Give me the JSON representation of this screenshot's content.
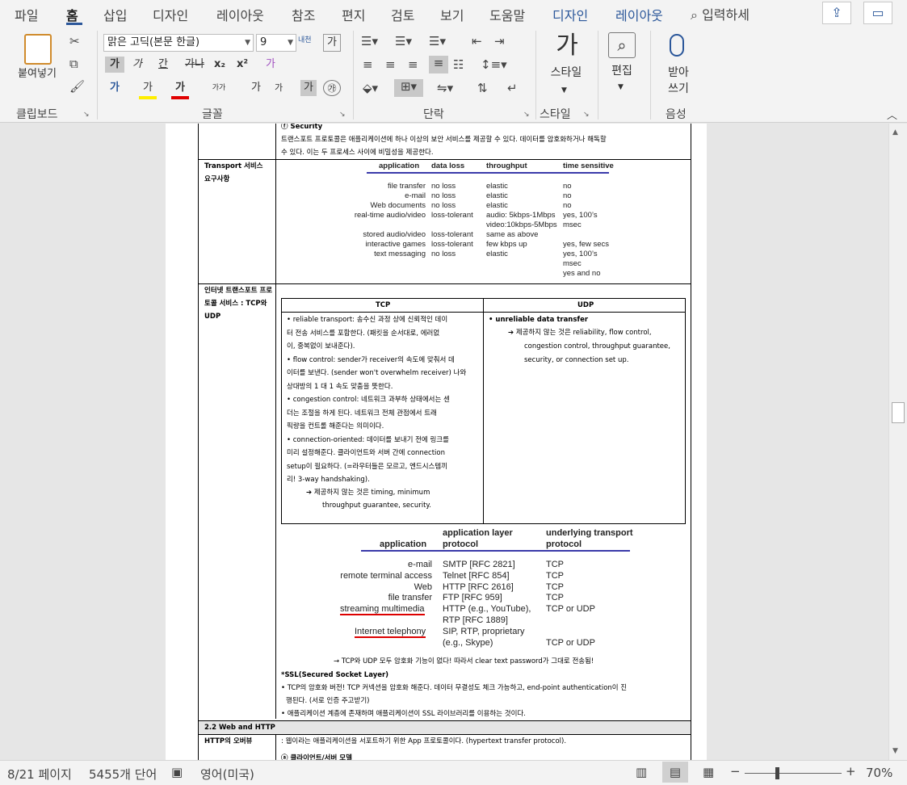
{
  "tabs": [
    {
      "label": "파일"
    },
    {
      "label": "홈"
    },
    {
      "label": "삽입"
    },
    {
      "label": "디자인"
    },
    {
      "label": "레이아웃"
    },
    {
      "label": "참조"
    },
    {
      "label": "편지"
    },
    {
      "label": "검토"
    },
    {
      "label": "보기"
    },
    {
      "label": "도움말"
    },
    {
      "label": "디자인"
    },
    {
      "label": "레이아웃"
    }
  ],
  "search": {
    "label": "입력하세"
  },
  "ribbon": {
    "clipboard": {
      "paste": "붙여넣기",
      "label": "클립보드"
    },
    "font": {
      "name": "맑은 고딕(본문 한글)",
      "size": "9",
      "label": "글꼴",
      "bold": "가",
      "italic": "가",
      "underline": "간",
      "strike": "가나",
      "sub": "x₂",
      "sup": "x²",
      "clear": "가",
      "highlight": "가",
      "color": "가",
      "phonetic": "가가",
      "grow": "가",
      "shrink": "가",
      "charborder": "가",
      "enclosed": "㉮",
      "charsp": "내천"
    },
    "paragraph": {
      "label": "단락"
    },
    "styles": {
      "label": "스타일",
      "button": "스타일",
      "glyph": "가"
    },
    "editing": {
      "label": "편집"
    },
    "voice": {
      "label": "음성",
      "button1": "받아",
      "button2": "쓰기"
    }
  },
  "doc": {
    "security_title": "ⓕ Security",
    "security_body1": "트랜스포트 프로토콜은 애플리케이션에 하나 이상의 보안 서비스를 제공할 수 있다. 데이터를 암호화하거나 해독할",
    "security_body2": "수 있다. 이는 두 프로세스 사이에 비밀성을 제공한다.",
    "req_label": "Transport 서비스 요구사항",
    "req_table": {
      "headers": [
        "application",
        "data loss",
        "throughput",
        "time sensitive"
      ],
      "rows": [
        [
          "file transfer",
          "no loss",
          "elastic",
          "no"
        ],
        [
          "e-mail",
          "no loss",
          "elastic",
          "no"
        ],
        [
          "Web documents",
          "no loss",
          "elastic",
          "no"
        ],
        [
          "real-time audio/video",
          "loss-tolerant",
          "audio: 5kbps-1Mbps",
          "yes, 100’s"
        ],
        [
          "",
          "",
          "video:10kbps-5Mbps",
          "msec"
        ],
        [
          "stored audio/video",
          "loss-tolerant",
          "same as above",
          ""
        ],
        [
          "interactive games",
          "loss-tolerant",
          "few kbps up",
          "yes, few secs"
        ],
        [
          "text messaging",
          "no loss",
          "elastic",
          "yes, 100’s"
        ],
        [
          "",
          "",
          "",
          "msec"
        ],
        [
          "",
          "",
          "",
          "yes and no"
        ]
      ]
    },
    "svc_label": "인터넷 트랜스포트 프로토콜 서비스 : TCP와 UDP",
    "tcp_header": "TCP",
    "udp_header": "UDP",
    "tcp_lines": [
      "• reliable transport: 송수신 과정 상에 신뢰적인 데이",
      "터 전송 서비스를 포함한다. (패킷을 순서대로, 에러없",
      "이, 중복없이 보내준다).",
      "• flow control: sender가 receiver의 속도에 맞춰서 데",
      "이터를 보낸다. (sender won't overwhelm receiver) 나와",
      "상대방의 1 대 1 속도 맞춤을 뜻한다.",
      "• congestion control: 네트워크 과부하 상태에서는 센",
      "더는 조절을 하게 된다.  네트워크 전체 관점에서 트래",
      "픽량을 컨트롤 해준다는 의미이다.",
      "• connection-oriented: 데이터를 보내기 전에 링크를",
      "미리 설정해준다. 클라이언트와 서버 간에 connection",
      "setup이 필요하다. (=라우터들은 모르고, 엔드시스템끼",
      "리! 3-way handshaking)."
    ],
    "tcp_note1": "➔  제공하지 않는 것은 timing, minimum",
    "tcp_note2": "throughput guarantee, security.",
    "udp_line1": "• unreliable data transfer",
    "udp_note1": "➔  제공하지 않는 것은 reliability, flow control,",
    "udp_note2": "congestion control, throughput guarantee,",
    "udp_note3": "security, or connection set up.",
    "app_table": {
      "headers": [
        "application",
        "application layer protocol",
        "underlying transport protocol"
      ],
      "rows": [
        [
          "e-mail",
          "SMTP [RFC 2821]",
          "TCP"
        ],
        [
          "remote terminal access",
          "Telnet [RFC 854]",
          "TCP"
        ],
        [
          "Web",
          "HTTP [RFC 2616]",
          "TCP"
        ],
        [
          "file transfer",
          "FTP [RFC 959]",
          "TCP"
        ],
        [
          "streaming multimedia",
          "HTTP (e.g., YouTube),",
          "TCP or UDP"
        ],
        [
          "",
          "RTP [RFC 1889]",
          ""
        ],
        [
          "Internet telephony",
          "SIP, RTP, proprietary",
          ""
        ],
        [
          "",
          "(e.g., Skype)",
          "TCP or UDP"
        ]
      ]
    },
    "note_arrow": "→ TCP와 UDP 모두 암호화 기능이 없다! 따라서 clear text password가 그대로 전송됨!",
    "ssl_title": "*SSL(Secured Socket Layer)",
    "ssl_line1": "• TCP의 암호화 버전! TCP 커넥션을 암호화 해준다. 데이터 무결성도 체크 가능하고, end-point authentication이 진",
    "ssl_line2": "행된다. (서로 인증 주고받기)",
    "ssl_line3": "• 애플리케이션 계층에 존재하며 애플리케이션이 SSL 라이브러리를 이용하는 것이다.",
    "section_22": "2.2 Web and HTTP",
    "http_label": "HTTP의 오버뷰",
    "http_body": ": 웹이라는 애플리케이션을 서포트하기 위한 App 프로토콜이다. (hypertext transfer protocol).",
    "http_sub": "ⓐ 클라이언트/서버 모델"
  },
  "status": {
    "page": "8/21 페이지",
    "words": "5455개 단어",
    "lang": "영어(미국)",
    "zoom": "70%"
  }
}
